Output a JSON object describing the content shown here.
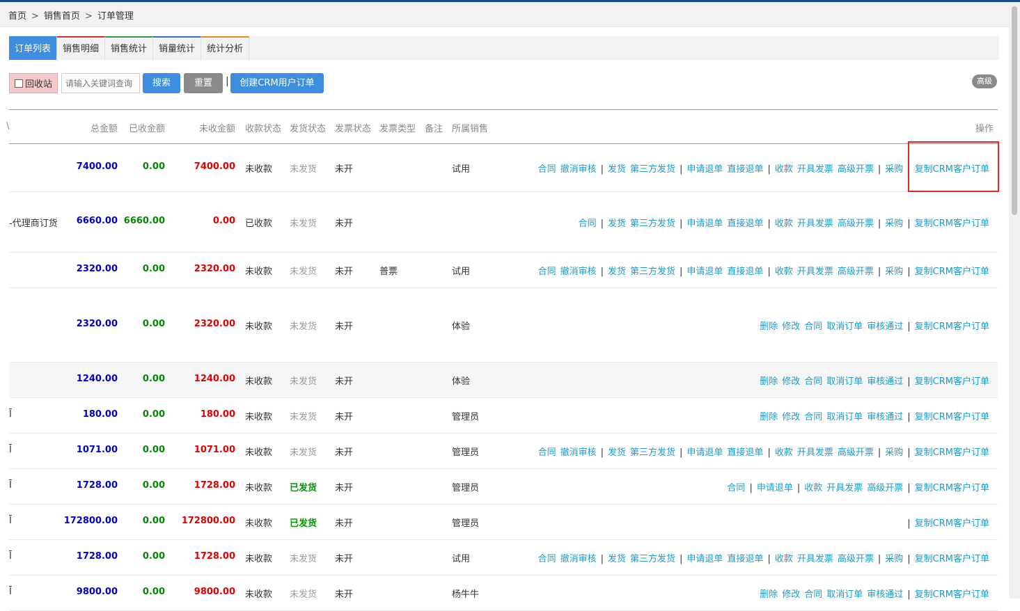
{
  "breadcrumb": {
    "items": [
      "首页",
      "销售首页",
      "订单管理"
    ],
    "separator": ">"
  },
  "tabs": [
    {
      "label": "订单列表",
      "active": true
    },
    {
      "label": "销售明细",
      "active": false
    },
    {
      "label": "销售统计",
      "active": false
    },
    {
      "label": "销量统计",
      "active": false
    },
    {
      "label": "统计分析",
      "active": false
    }
  ],
  "toolbar": {
    "recycle_label": "回收站",
    "search_placeholder": "请输入关键词查询",
    "search_label": "搜索",
    "reset_label": "重置",
    "separator": "|",
    "create_label": "创建CRM用户订单",
    "advanced_label": "高级"
  },
  "table": {
    "columns": [
      "\\",
      "总金额",
      "已收金额",
      "未收金额",
      "收款状态",
      "发货状态",
      "发票状态",
      "发票类型",
      "备注",
      "所属销售",
      "操作"
    ],
    "rows": [
      {
        "name": "",
        "total": "7400.00",
        "paid": "0.00",
        "unpaid": "7400.00",
        "pay_status": "未收款",
        "ship_status": "未发货",
        "invoice_status": "未开",
        "invoice_type": "",
        "remark": "",
        "sales": "试用",
        "ops": [
          "合同",
          "撤消审核",
          "|",
          "发货",
          "第三方发货",
          "|",
          "申请退单",
          "直接退单",
          "|",
          "收款",
          "开具发票",
          "高级开票",
          "|",
          "采购",
          "|",
          "复制CRM客户订单"
        ]
      },
      {
        "name": "-代理商订货",
        "total": "6660.00",
        "paid": "6660.00",
        "unpaid": "0.00",
        "pay_status": "已收款",
        "ship_status": "未发货",
        "invoice_status": "未开",
        "invoice_type": "",
        "remark": "",
        "sales": "",
        "ops": [
          "合同",
          "|",
          "发货",
          "第三方发货",
          "|",
          "申请退单",
          "直接退单",
          "|",
          "收款",
          "开具发票",
          "高级开票",
          "|",
          "采购",
          "|",
          "复制CRM客户订单"
        ]
      },
      {
        "name": "",
        "total": "2320.00",
        "paid": "0.00",
        "unpaid": "2320.00",
        "pay_status": "未收款",
        "ship_status": "未发货",
        "invoice_status": "未开",
        "invoice_type": "普票",
        "remark": "",
        "sales": "试用",
        "ops": [
          "合同",
          "撤消审核",
          "|",
          "发货",
          "第三方发货",
          "|",
          "申请退单",
          "直接退单",
          "|",
          "收款",
          "开具发票",
          "高级开票",
          "|",
          "采购",
          "|",
          "复制CRM客户订单"
        ]
      },
      {
        "name": "",
        "total": "2320.00",
        "paid": "0.00",
        "unpaid": "2320.00",
        "pay_status": "未收款",
        "ship_status": "未发货",
        "invoice_status": "未开",
        "invoice_type": "",
        "remark": "",
        "sales": "体验",
        "ops": [
          "删除",
          "修改",
          "合同",
          "取消订单",
          "审核通过",
          "|",
          "复制CRM客户订单"
        ]
      },
      {
        "name": "",
        "total": "1240.00",
        "paid": "0.00",
        "unpaid": "1240.00",
        "pay_status": "未收款",
        "ship_status": "未发货",
        "invoice_status": "未开",
        "invoice_type": "",
        "remark": "",
        "sales": "体验",
        "ops": [
          "删除",
          "修改",
          "合同",
          "取消订单",
          "审核通过",
          "|",
          "复制CRM客户订单"
        ]
      },
      {
        "name": "Ī",
        "total": "180.00",
        "paid": "0.00",
        "unpaid": "180.00",
        "pay_status": "未收款",
        "ship_status": "未发货",
        "invoice_status": "未开",
        "invoice_type": "",
        "remark": "",
        "sales": "管理员",
        "ops": [
          "删除",
          "修改",
          "合同",
          "取消订单",
          "审核通过",
          "|",
          "复制CRM客户订单"
        ]
      },
      {
        "name": "Ī",
        "total": "1071.00",
        "paid": "0.00",
        "unpaid": "1071.00",
        "pay_status": "未收款",
        "ship_status": "未发货",
        "invoice_status": "未开",
        "invoice_type": "",
        "remark": "",
        "sales": "管理员",
        "ops": [
          "合同",
          "撤消审核",
          "|",
          "发货",
          "第三方发货",
          "|",
          "申请退单",
          "直接退单",
          "|",
          "收款",
          "开具发票",
          "高级开票",
          "|",
          "采购",
          "|",
          "复制CRM客户订单"
        ]
      },
      {
        "name": "Ī",
        "total": "1728.00",
        "paid": "0.00",
        "unpaid": "1728.00",
        "pay_status": "未收款",
        "ship_status": "已发货",
        "invoice_status": "未开",
        "invoice_type": "",
        "remark": "",
        "sales": "管理员",
        "ops": [
          "合同",
          "|",
          "申请退单",
          "|",
          "收款",
          "开具发票",
          "高级开票",
          "|",
          "复制CRM客户订单"
        ]
      },
      {
        "name": "Ī",
        "total": "172800.00",
        "paid": "0.00",
        "unpaid": "172800.00",
        "pay_status": "未收款",
        "ship_status": "已发货",
        "invoice_status": "未开",
        "invoice_type": "",
        "remark": "",
        "sales": "管理员",
        "ops": [
          "|",
          "复制CRM客户订单"
        ]
      },
      {
        "name": "Ī",
        "total": "1728.00",
        "paid": "0.00",
        "unpaid": "1728.00",
        "pay_status": "未收款",
        "ship_status": "未发货",
        "invoice_status": "未开",
        "invoice_type": "",
        "remark": "",
        "sales": "试用",
        "ops": [
          "合同",
          "撤消审核",
          "|",
          "发货",
          "第三方发货",
          "|",
          "申请退单",
          "直接退单",
          "|",
          "收款",
          "开具发票",
          "高级开票",
          "|",
          "采购",
          "|",
          "复制CRM客户订单"
        ]
      },
      {
        "name": "Ī",
        "total": "9800.00",
        "paid": "0.00",
        "unpaid": "9800.00",
        "pay_status": "未收款",
        "ship_status": "未发货",
        "invoice_status": "未开",
        "invoice_type": "",
        "remark": "",
        "sales": "杨牛牛",
        "ops": [
          "删除",
          "修改",
          "合同",
          "取消订单",
          "审核通过",
          "|",
          "复制CRM客户订单"
        ]
      }
    ]
  },
  "colors": {
    "accent": "#3d8ee0",
    "link": "#1a9ccc",
    "total": "#0000cc",
    "paid": "#008800",
    "unpaid": "#e00000",
    "highlight": "#ee2222"
  }
}
